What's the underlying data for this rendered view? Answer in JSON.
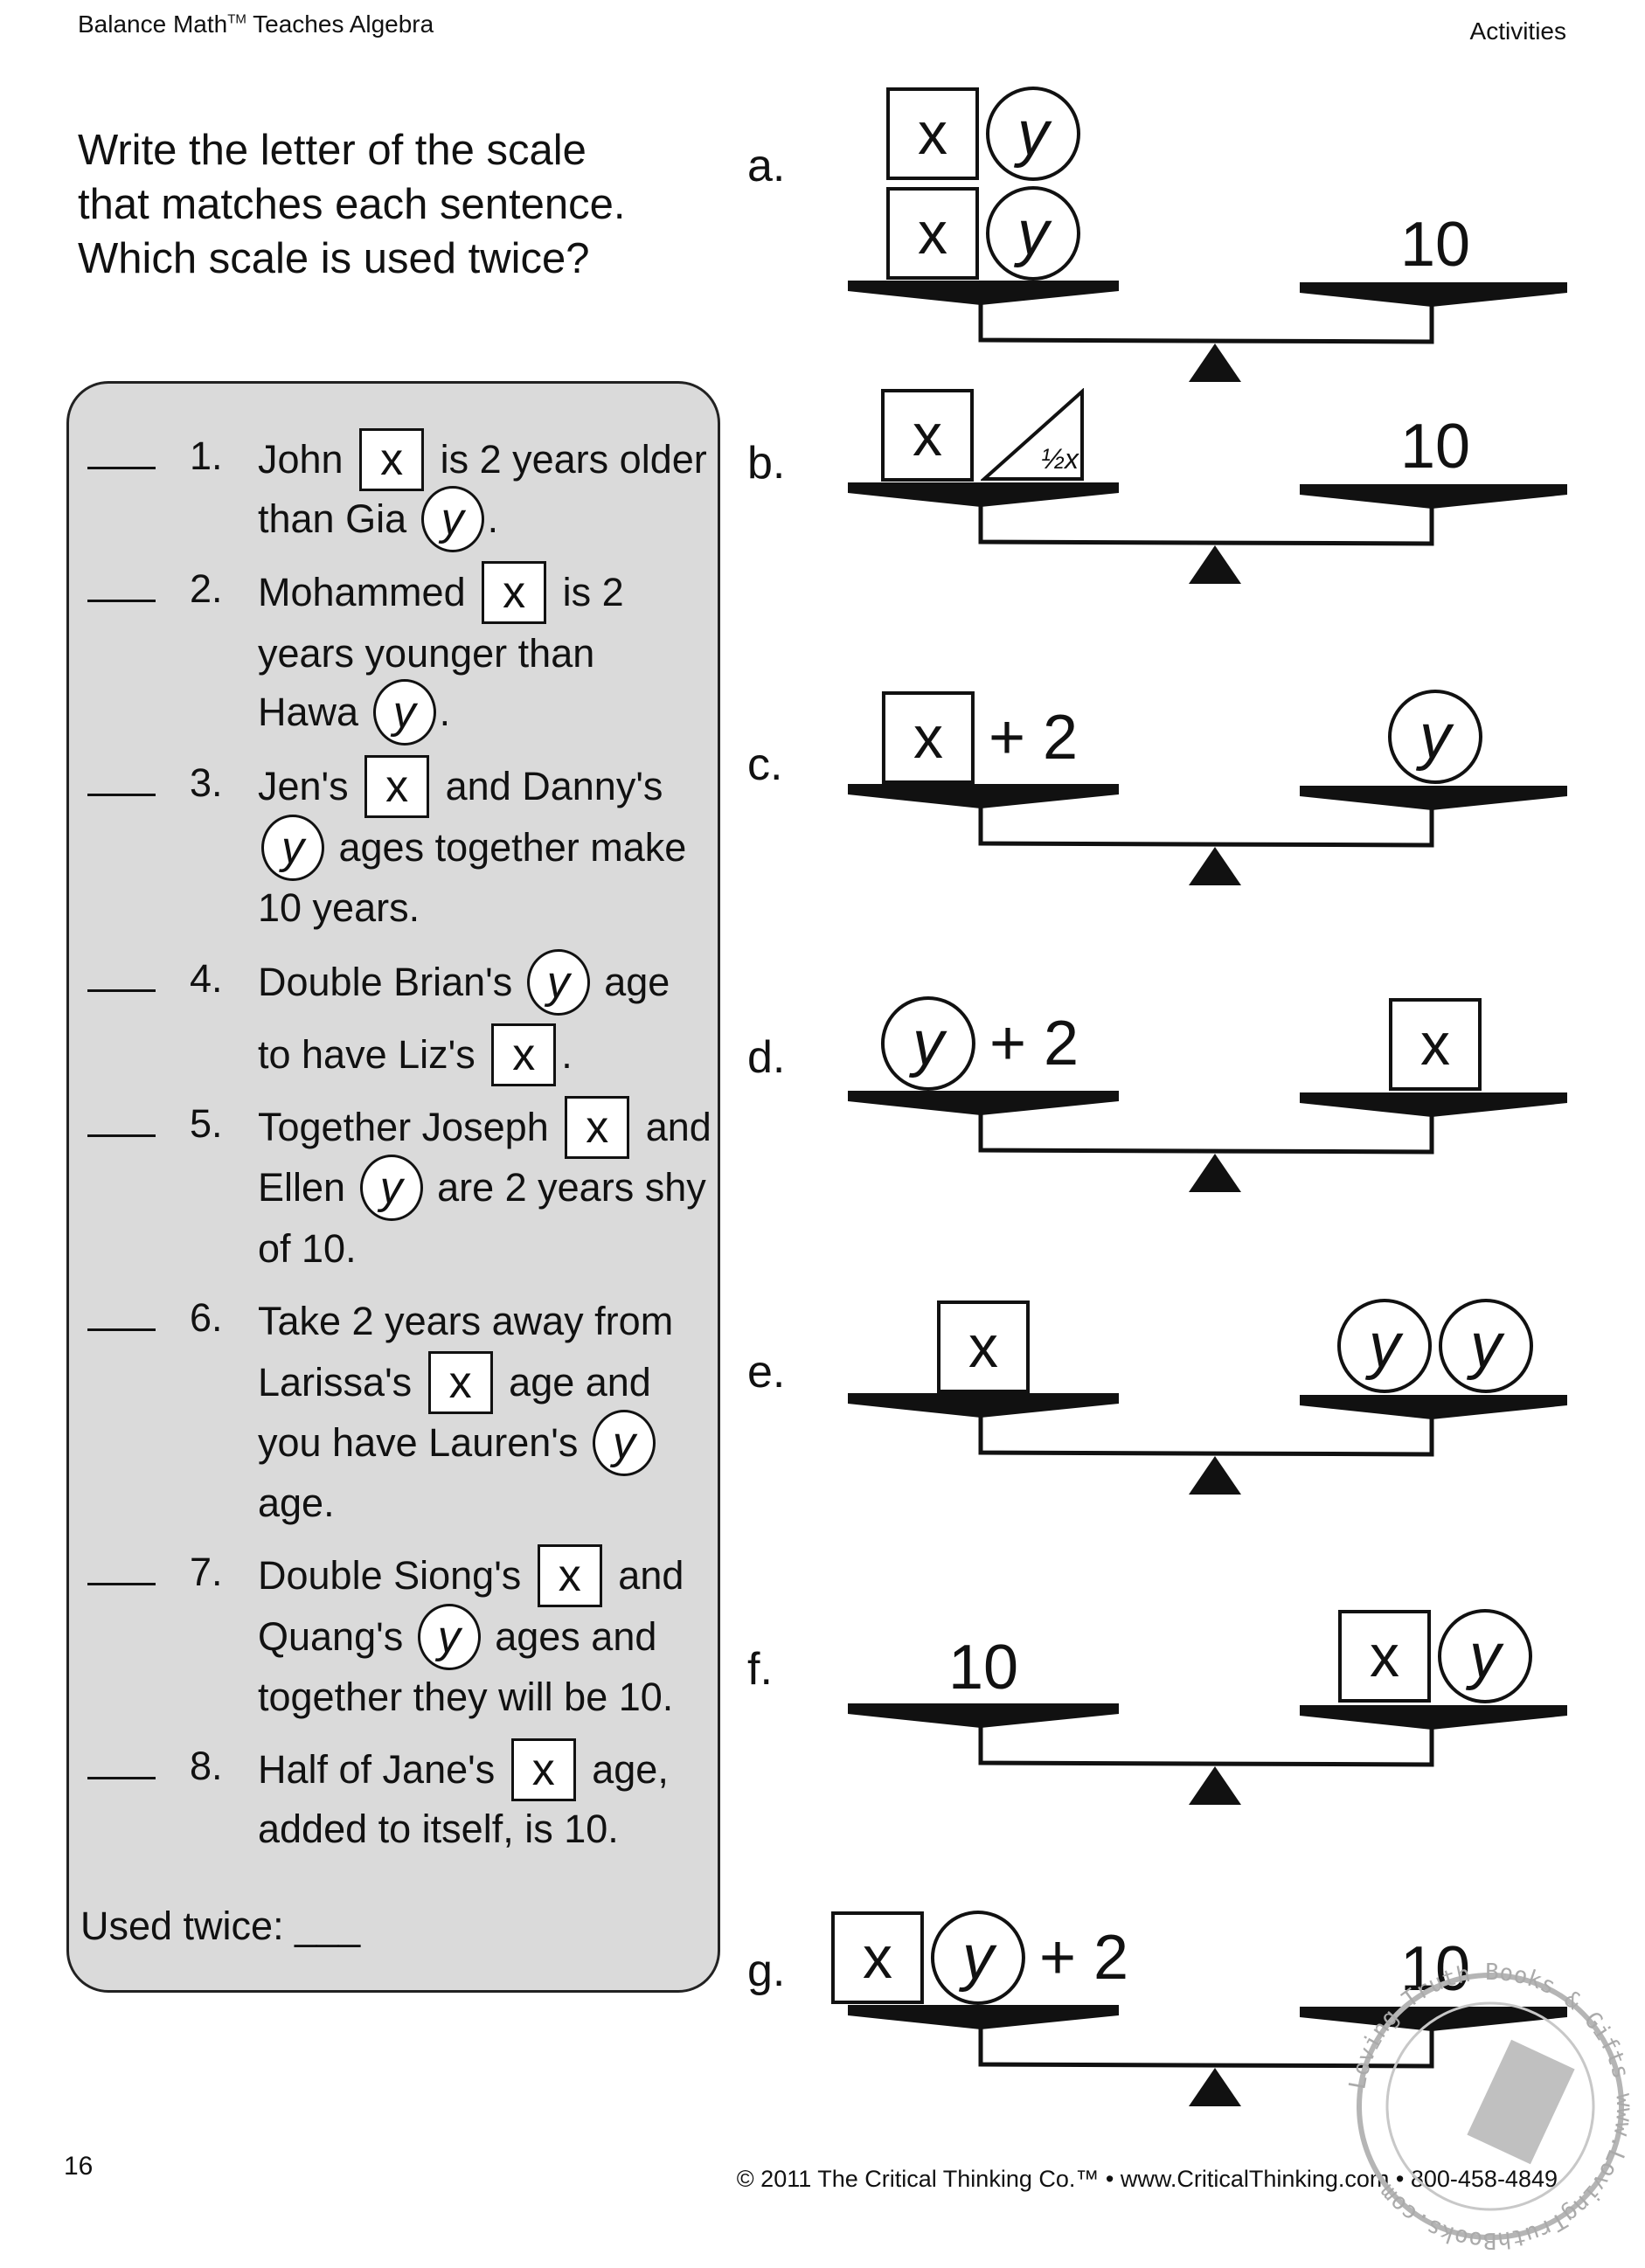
{
  "header": {
    "book_title": "Balance Math",
    "trademark": "TM",
    "book_subtitle": " Teaches Algebra",
    "section": "Activities"
  },
  "instructions": [
    "Write the letter of the scale",
    "that matches each sentence.",
    "Which scale is used twice?"
  ],
  "items": [
    {
      "number": "1.",
      "lines": [
        [
          {
            "t": "John "
          },
          {
            "box": "x"
          },
          {
            "t": " is 2 years older"
          }
        ],
        [
          {
            "t": "than Gia "
          },
          {
            "circ": "y"
          },
          {
            "t": "."
          }
        ]
      ]
    },
    {
      "number": "2.",
      "lines": [
        [
          {
            "t": "Mohammed "
          },
          {
            "box": "x"
          },
          {
            "t": " is 2"
          }
        ],
        [
          {
            "t": "years younger than"
          }
        ],
        [
          {
            "t": "Hawa "
          },
          {
            "circ": "y"
          },
          {
            "t": "."
          }
        ]
      ]
    },
    {
      "number": "3.",
      "lines": [
        [
          {
            "t": "Jen's "
          },
          {
            "box": "x"
          },
          {
            "t": " and Danny's"
          }
        ],
        [
          {
            "circ": "y"
          },
          {
            "t": " ages together make"
          }
        ],
        [
          {
            "t": "10 years."
          }
        ]
      ]
    },
    {
      "number": "4.",
      "lines": [
        [
          {
            "t": "Double Brian's "
          },
          {
            "circ": "y"
          },
          {
            "t": " age"
          }
        ],
        [
          {
            "t": "to have Liz's "
          },
          {
            "box": "x"
          },
          {
            "t": "."
          }
        ]
      ]
    },
    {
      "number": "5.",
      "lines": [
        [
          {
            "t": "Together Joseph "
          },
          {
            "box": "x"
          },
          {
            "t": " and"
          }
        ],
        [
          {
            "t": "Ellen "
          },
          {
            "circ": "y"
          },
          {
            "t": " are 2 years shy"
          }
        ],
        [
          {
            "t": "of 10."
          }
        ]
      ]
    },
    {
      "number": "6.",
      "lines": [
        [
          {
            "t": "Take 2 years away from"
          }
        ],
        [
          {
            "t": "Larissa's "
          },
          {
            "box": "x"
          },
          {
            "t": " age and"
          }
        ],
        [
          {
            "t": "you have Lauren's "
          },
          {
            "circ": "y"
          }
        ],
        [
          {
            "t": "age."
          }
        ]
      ]
    },
    {
      "number": "7.",
      "lines": [
        [
          {
            "t": "Double Siong's "
          },
          {
            "box": "x"
          },
          {
            "t": " and"
          }
        ],
        [
          {
            "t": "Quang's "
          },
          {
            "circ": "y"
          },
          {
            "t": " ages and"
          }
        ],
        [
          {
            "t": "together they will be 10."
          }
        ]
      ]
    },
    {
      "number": "8.",
      "lines": [
        [
          {
            "t": "Half of Jane's "
          },
          {
            "box": "x"
          },
          {
            "t": " age,"
          }
        ],
        [
          {
            "t": "added to itself, is 10."
          }
        ]
      ]
    }
  ],
  "used_twice_label": "Used twice: ___",
  "scales": [
    {
      "letter": "a.",
      "left": [
        [
          {
            "box": "x"
          },
          {
            "circ": "y"
          }
        ],
        [
          {
            "box": "x"
          },
          {
            "circ": "y"
          }
        ]
      ],
      "right": [
        [
          {
            "t": "10"
          }
        ]
      ]
    },
    {
      "letter": "b.",
      "left": [
        [
          {
            "box": "x"
          },
          {
            "tri": "½x"
          }
        ]
      ],
      "right": [
        [
          {
            "t": "10"
          }
        ]
      ]
    },
    {
      "letter": "c.",
      "left": [
        [
          {
            "box": "x"
          },
          {
            "t": "+ 2"
          }
        ]
      ],
      "right": [
        [
          {
            "circ": "y"
          }
        ]
      ]
    },
    {
      "letter": "d.",
      "left": [
        [
          {
            "circ": "y"
          },
          {
            "t": "+ 2"
          }
        ]
      ],
      "right": [
        [
          {
            "box": "x"
          }
        ]
      ]
    },
    {
      "letter": "e.",
      "left": [
        [
          {
            "box": "x"
          }
        ]
      ],
      "right": [
        [
          {
            "circ": "y"
          },
          {
            "circ": "y"
          }
        ]
      ]
    },
    {
      "letter": "f.",
      "left": [
        [
          {
            "t": "10"
          }
        ]
      ],
      "right": [
        [
          {
            "box": "x"
          },
          {
            "circ": "y"
          }
        ]
      ]
    },
    {
      "letter": "g.",
      "left": [
        [
          {
            "box": "x"
          },
          {
            "circ": "y"
          },
          {
            "t": "+ 2"
          }
        ]
      ],
      "right": [
        [
          {
            "t": "10"
          }
        ]
      ]
    }
  ],
  "footer": {
    "page_number": "16",
    "copyright": "© 2011 The Critical Thinking Co.™ • www.CriticalThinking.com • 800-458-4849"
  },
  "watermark": {
    "text_top": "Loving Truth Books & Gifts",
    "text_url": "www.LovingTruthBooks.com",
    "color": "#b5b5b5"
  },
  "colors": {
    "panel_bg": "#dadada",
    "ink": "#111111"
  }
}
